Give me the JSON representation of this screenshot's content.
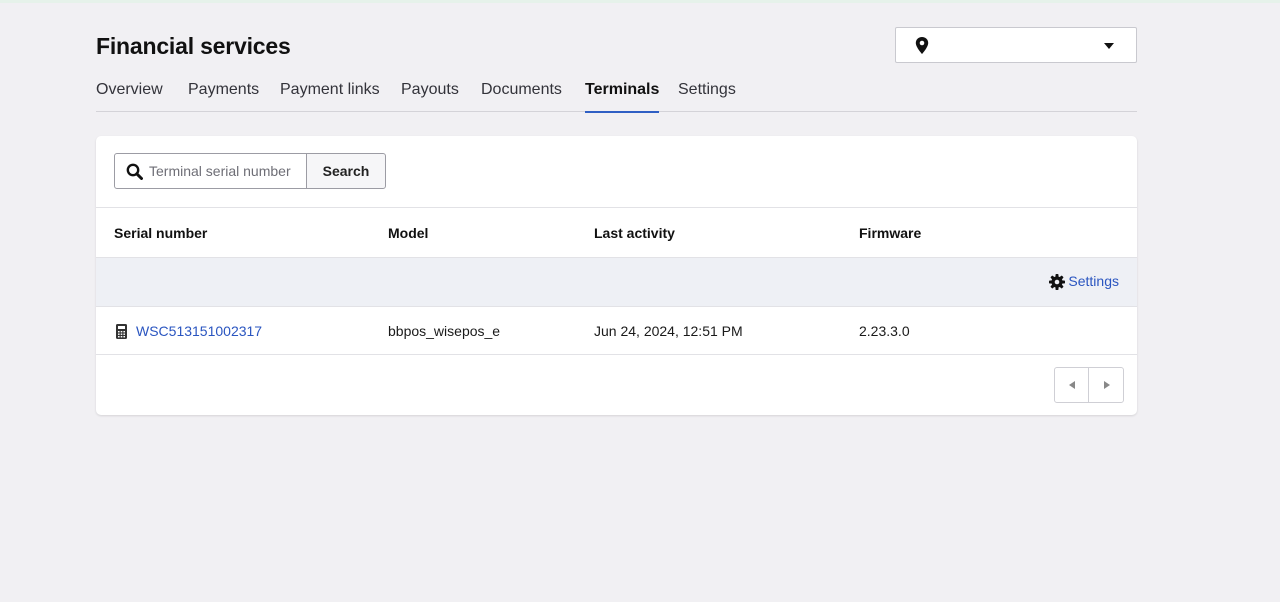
{
  "header": {
    "title": "Financial services",
    "location_select": {
      "value": "",
      "icon": "map-pin-icon"
    }
  },
  "tabs": [
    {
      "label": "Overview"
    },
    {
      "label": "Payments"
    },
    {
      "label": "Payment links"
    },
    {
      "label": "Payouts"
    },
    {
      "label": "Documents"
    },
    {
      "label": "Terminals",
      "active": true
    },
    {
      "label": "Settings"
    }
  ],
  "search": {
    "placeholder": "Terminal serial number",
    "value": "",
    "button_label": "Search"
  },
  "table": {
    "columns": [
      "Serial number",
      "Model",
      "Last activity",
      "Firmware"
    ],
    "settings_label": "Settings",
    "rows": [
      {
        "serial": "WSC513151002317",
        "model": "bbpos_wisepos_e",
        "last_activity": "Jun 24, 2024, 12:51 PM",
        "firmware": "2.23.3.0"
      }
    ]
  },
  "colors": {
    "accent": "#2f5fc4",
    "link": "#2a55c0",
    "background": "#f1f0f3"
  }
}
